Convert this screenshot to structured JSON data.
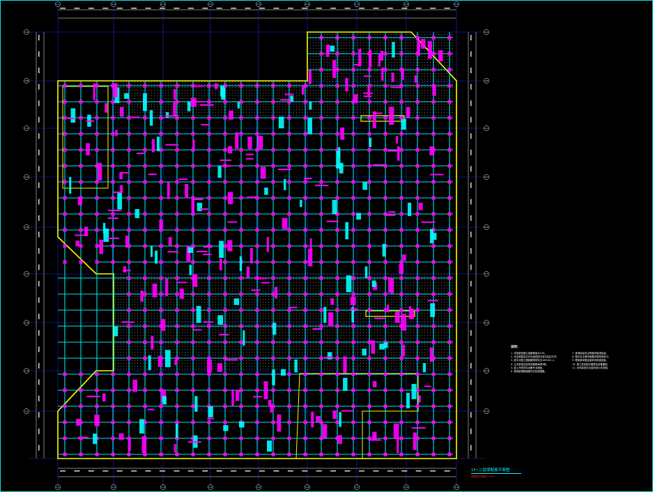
{
  "drawing": {
    "colors": {
      "background": "#000000",
      "axis_line": "#1e2bd8",
      "boundary": "#ffff00",
      "beam": "#00ffff",
      "column": "#ff00ff",
      "annotation_magenta": "#ff00ff",
      "annotation_cyan": "#00ffff",
      "hatch": "#c8c8c8",
      "dimension": "#ffffff",
      "title_text": "#00ffff",
      "title_sub": "#ff2020"
    },
    "axis_labels": {
      "top": [
        "1-1",
        "1-2",
        "1-3",
        "1-4",
        "1-5",
        "1-6",
        "1-7",
        "1-8",
        "1-9"
      ],
      "bottom": [
        "1-1",
        "1-2",
        "1-3",
        "1-4",
        "1-5",
        "1-6",
        "1-7",
        "1-8",
        "1-9"
      ],
      "left": [
        "1-A",
        "1-B",
        "1-C",
        "1-D",
        "1-E",
        "1-F",
        "1-G",
        "1-H",
        "1-J"
      ],
      "right": [
        "1-A",
        "1-B",
        "1-C",
        "1-D",
        "1-E",
        "1-F",
        "1-G",
        "1-H",
        "1-J"
      ]
    },
    "notes": {
      "heading": "说明：",
      "col1": [
        "1. 本层梁混凝土强度等级为C30。",
        "2. 未注明梁定位均为轴线居中或与柱边平齐。",
        "3. 梁平法施工图制图规则详见16G101-1。",
        "4. 主次梁相交处附加箍筋每侧3根。",
        "5. 梁上开洞详见设备专业图纸。",
        "6. 悬挑梁钢筋锚固详见标准图集。"
      ],
      "col2": [
        "7. 梁顶标高未注明者同板顶标高。",
        "8. 图中未注明构造要求按规范执行。",
        "9. 框架梁纵筋连接采用机械连接。",
        "10. 施工前应核对建筑及设备图纸。",
        "11. 未尽事宜详见结构设计总说明。"
      ]
    },
    "title": "1F~二层梁配筋平面图",
    "title_sub": "梁配筋平面图 1:100"
  }
}
